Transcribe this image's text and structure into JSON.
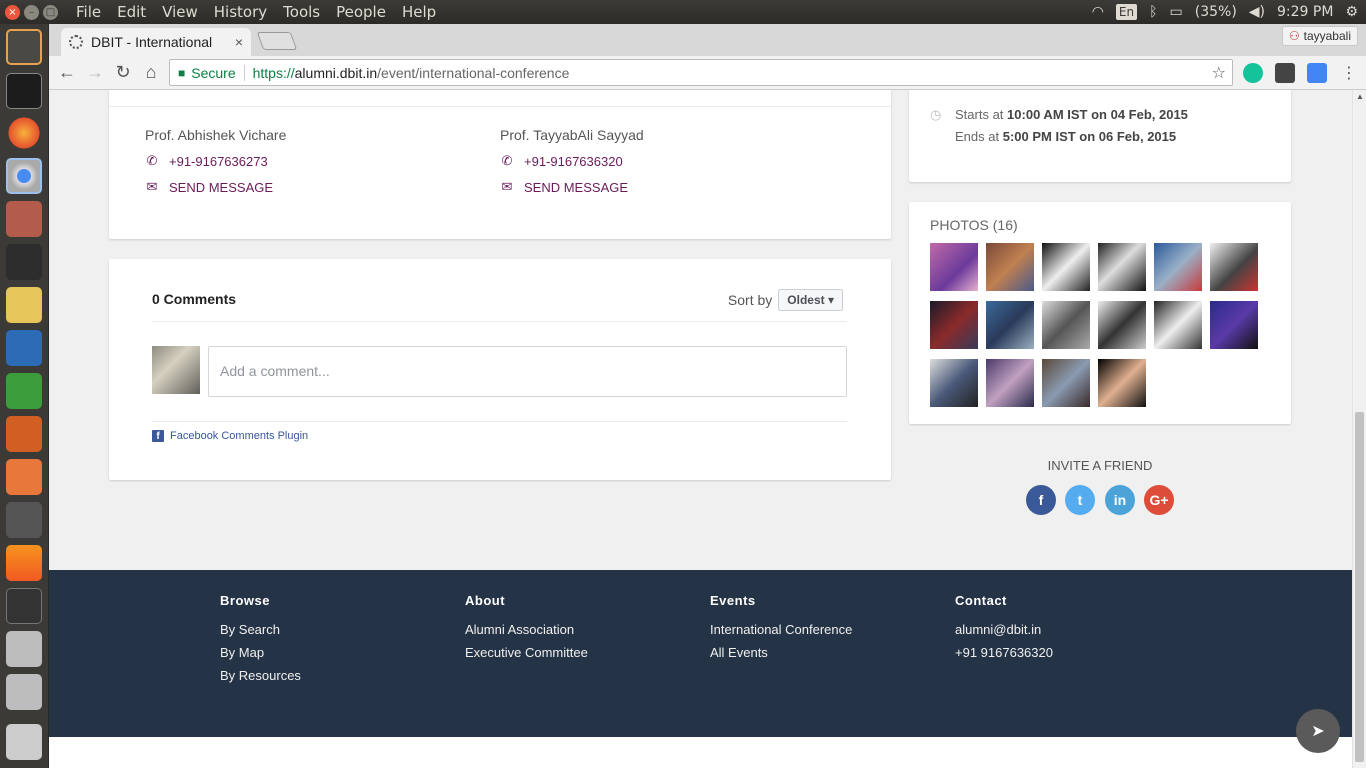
{
  "system": {
    "menu": [
      "File",
      "Edit",
      "View",
      "History",
      "Tools",
      "People",
      "Help"
    ],
    "lang": "En",
    "battery": "(35%)",
    "time": "9:29 PM"
  },
  "browser": {
    "tab_title": "DBIT - International",
    "tab_close": "×",
    "profile_name": "tayyabali",
    "secure_label": "Secure",
    "url_scheme": "https://",
    "url_host": "alumni.dbit.in",
    "url_path": "/event/international-conference"
  },
  "contacts": [
    {
      "name": "Prof. Abhishek Vichare",
      "phone": "+91-9167636273",
      "message": "SEND MESSAGE"
    },
    {
      "name": "Prof. TayyabAli Sayyad",
      "phone": "+91-9167636320",
      "message": "SEND MESSAGE"
    }
  ],
  "comments": {
    "count_label": "0 Comments",
    "sort_label": "Sort by",
    "sort_value": "Oldest",
    "placeholder": "Add a comment...",
    "plugin_label": "Facebook Comments Plugin"
  },
  "event": {
    "starts_prefix": "Starts at",
    "starts_value": "10:00 AM IST on 04 Feb, 2015",
    "ends_prefix": "Ends at",
    "ends_value": "5:00 PM IST on 06 Feb, 2015"
  },
  "photos": {
    "title": "PHOTOS (16)",
    "count": 16
  },
  "invite": {
    "title": "INVITE A FRIEND",
    "networks": [
      {
        "name": "facebook",
        "glyph": "f",
        "color": "#3b5998"
      },
      {
        "name": "twitter",
        "glyph": "t",
        "color": "#55acee"
      },
      {
        "name": "linkedin",
        "glyph": "in",
        "color": "#4ba3d8"
      },
      {
        "name": "google-plus",
        "glyph": "G+",
        "color": "#dd4b39"
      }
    ]
  },
  "footer": {
    "browse": {
      "title": "Browse",
      "links": [
        "By Search",
        "By Map",
        "By Resources"
      ]
    },
    "about": {
      "title": "About",
      "links": [
        "Alumni Association",
        "Executive Committee"
      ]
    },
    "events": {
      "title": "Events",
      "links": [
        "International Conference",
        "All Events"
      ]
    },
    "contact": {
      "title": "Contact",
      "links": [
        "alumni@dbit.in",
        "+91 9167636320"
      ]
    }
  },
  "colors": {
    "brand": "#6a1b5a",
    "footer_bg": "#253346"
  }
}
